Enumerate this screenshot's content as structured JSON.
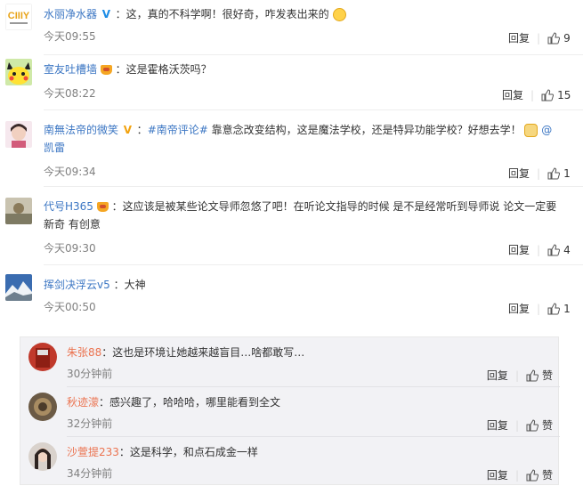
{
  "panel_top": {
    "comments": [
      {
        "username": "水丽净水器",
        "badge": "verified-blue",
        "text": "：这，真的不科学啊！很好奇，咋发表出来的",
        "emoji": "face-emoji",
        "time": "今天09:55",
        "reply_label": "回复",
        "likes": "9"
      },
      {
        "username": "室友吐槽墙",
        "badge": "crown",
        "text": "：这是霍格沃茨吗？",
        "time": "今天08:22",
        "reply_label": "回复",
        "likes": "15"
      },
      {
        "username": "南無法帝的微笑",
        "badge": "verified-gold",
        "topic": "#南帝评论#",
        "text": " 靠意念改变结构，这是魔法学校，还是特异功能学校？好想去学！",
        "mention_line1": "@",
        "mention_line2": "凯雷",
        "time": "今天09:34",
        "reply_label": "回复",
        "likes": "1"
      },
      {
        "username": "代号H365",
        "badge": "crown",
        "text_line1": "：这应该是被某些论文导师忽悠了吧！在听论文指导的时候 是不是经常听到导师说 论文一定要",
        "text_line2": "新奇 有创意",
        "time": "今天09:30",
        "reply_label": "回复",
        "likes": "4"
      },
      {
        "username": "挥剑决浮云v5",
        "text": "：大神",
        "time": "今天00:50",
        "reply_label": "回复",
        "likes": "1"
      }
    ]
  },
  "panel_bottom": {
    "comments": [
      {
        "username": "朱张88",
        "text": "：这也是环境让她越来越盲目…啥都敢写…",
        "time": "30分钟前",
        "reply_label": "回复",
        "like_label": "赞"
      },
      {
        "username": "秋迹濛",
        "text": "：感兴趣了，哈哈哈，哪里能看到全文",
        "time": "32分钟前",
        "reply_label": "回复",
        "like_label": "赞"
      },
      {
        "username": "沙萱提233",
        "text": "：这是科学，和点石成金一样",
        "time": "34分钟前",
        "reply_label": "回复",
        "like_label": "赞"
      }
    ]
  }
}
